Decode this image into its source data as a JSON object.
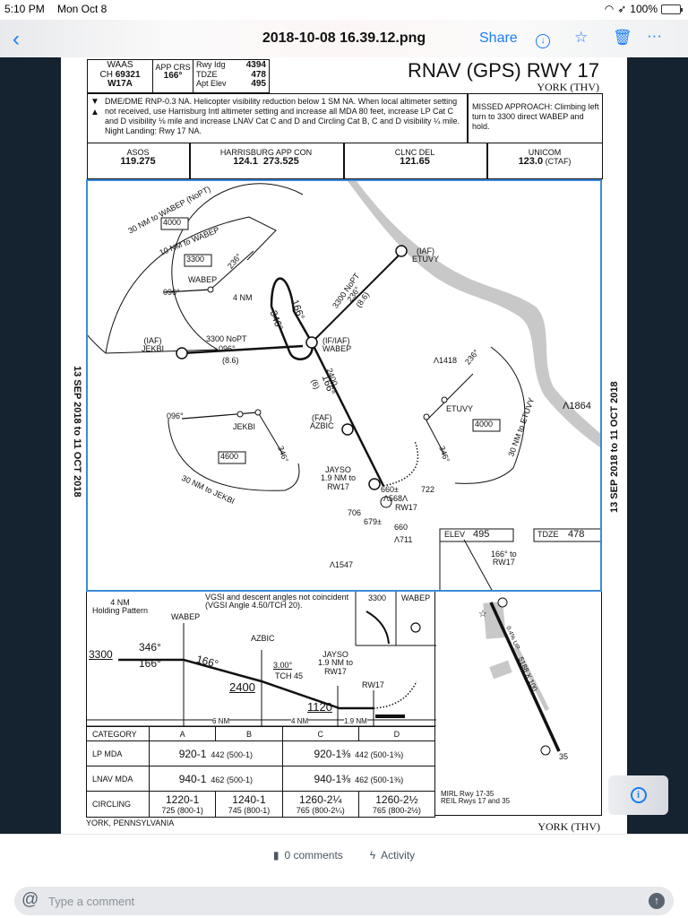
{
  "status_bar": {
    "time": "5:10 PM",
    "date": "Mon Oct 8",
    "battery": "100%"
  },
  "nav": {
    "back_label": "‹",
    "title": "2018-10-08 16.39.12.png",
    "share_label": "Share",
    "icons": [
      "download-icon",
      "star-icon",
      "trash-icon",
      "more-icon"
    ]
  },
  "chart": {
    "validity": "13 SEP 2018 to 11 OCT 2018",
    "header": {
      "waas_label": "WAAS",
      "ch_label": "CH",
      "ch_value": "69321",
      "waas_id": "W17A",
      "app_crs_label": "APP CRS",
      "app_crs_value": "166°",
      "rwy_ldg_label": "Rwy Idg",
      "rwy_ldg_value": "4394",
      "tdze_label": "TDZE",
      "tdze_value": "478",
      "apt_elev_label": "Apt Elev",
      "apt_elev_value": "495",
      "title": "RNAV (GPS) RWY 17",
      "subtitle": "YORK (THV)"
    },
    "notes": "DME/DME RNP-0.3 NA.  Helicopter visibility reduction below 1 SM NA.  When local altimeter setting not received, use Harrisburg Intl altimeter setting and increase all MDA 80 feet, increase LP Cat C and D visibility ⅛ mile and increase LNAV Cat C and D and Circling Cat B, C and D visibility ¼ mile. Night Landing: Rwy 17 NA.",
    "missed_approach": "MISSED APPROACH: Climbing left turn to 3300 direct WABEP and hold.",
    "comms": [
      {
        "label": "ASOS",
        "value": "119.275"
      },
      {
        "label": "HARRISBURG APP CON",
        "value": "124.1  273.525"
      },
      {
        "label": "CLNC DEL",
        "value": "121.65"
      },
      {
        "label": "UNICOM",
        "value": "123.0",
        "suffix": "(CTAF)"
      }
    ],
    "plan": {
      "taa_nw_outer": "30 NM to WABEP (NoPT)",
      "taa_nw_inner": "10 NM to WABEP",
      "taa_nw_alt_outer": "4000",
      "taa_nw_alt_inner": "3300",
      "taa_nw_fix": "WABEP",
      "taa_nw_096": "096°",
      "taa_nw_236": "236°",
      "hold_4nm": "4 NM",
      "hold_166": "166°",
      "hold_346": "346°",
      "jekbi_iaf": "(IAF)\nJEKBI",
      "jekbi_leg": "3300 NoPT",
      "jekbi_crs": "096°",
      "jekbi_dist": "(8.6)",
      "etuvy_iaf": "(IAF)\nETUVY",
      "etuvy_leg": "3300 NoPT",
      "etuvy_crs": "236°",
      "etuvy_dist": "(8.6)",
      "wabep_if": "(IF/IAF)\nWABEP",
      "seg_alt": "2400",
      "seg_crs": "166°",
      "seg_dist": "(6)",
      "faf": "(FAF)\nAZBIC",
      "jayso": "JAYSO\n1.9 NM to\nRW17",
      "taa_sw_096": "096°",
      "taa_sw_fix": "JEKBI",
      "taa_sw_alt": "4600",
      "taa_sw_346": "346°",
      "taa_sw_arc": "30 NM to JEKBI",
      "taa_e_236": "236°",
      "taa_e_fix": "ETUVY",
      "taa_e_alt": "4000",
      "taa_e_346": "346°",
      "taa_e_arc": "30 NM to ETUVY",
      "obstacles": [
        "1418",
        "1864",
        "660±",
        "722",
        "568",
        "706",
        "679±",
        "660",
        "711",
        "1547"
      ],
      "rw17": "RW17",
      "elev_label": "ELEV",
      "elev_value": "495",
      "tdze_label": "TDZE",
      "tdze_value": "478",
      "crs_to_rw": "166° to\nRW17"
    },
    "profile": {
      "holding_note": "4 NM\nHolding Pattern",
      "wabep": "WABEP",
      "vgsi_note": "VGSI and descent angles not coincident\n(VGSI Angle 4.50/TCH 20).",
      "alt_3300": "3300",
      "crs_346": "346°",
      "crs_166a": "166°",
      "crs_166b": "166°",
      "azbic": "AZBIC",
      "alt_2400": "2400",
      "gs_angle": "3.00°",
      "tch": "TCH 45",
      "jayso": "JAYSO\n1.9 NM to\nRW17",
      "rw17": "RW17",
      "alt_1120": "1120",
      "dist_6": "6 NM",
      "dist_4": "4 NM",
      "dist_19": "1.9 NM",
      "ma_icon_alt": "3300",
      "ma_icon_fix": "WABEP"
    },
    "minimums": {
      "headers": [
        "CATEGORY",
        "A",
        "B",
        "C",
        "D"
      ],
      "lp": {
        "label": "LP MDA",
        "ab_main": "920-1",
        "ab_sub": "442 (500-1)",
        "cd_main": "920-1⅜",
        "cd_sub": "442 (500-1⅜)"
      },
      "lnav": {
        "label": "LNAV MDA",
        "ab_main": "940-1",
        "ab_sub": "462 (500-1)",
        "cd_main": "940-1⅜",
        "cd_sub": "462 (500-1⅜)"
      },
      "circling": {
        "label": "CIRCLING",
        "a_main": "1220-1",
        "a_sub": "725 (800-1)",
        "b_main": "1240-1",
        "b_sub": "745 (800-1)",
        "c_main": "1260-2¼",
        "c_sub": "765 (800-2¼)",
        "d_main": "1260-2½",
        "d_sub": "765 (800-2½)"
      }
    },
    "airport": {
      "runway_dims": "5188 X 100",
      "gradient": "0.4% UP",
      "rwy_end": "35",
      "lighting": "MIRL Rwy 17-35\nREIL Rwys 17 and 35"
    },
    "footer_left": "YORK, PENNSYLVANIA",
    "footer_right": "YORK (THV)"
  },
  "bottom": {
    "comments_tab": "0 comments",
    "activity_tab": "Activity",
    "comment_placeholder": "Type a comment"
  },
  "colors": {
    "accent": "#1a7cf5",
    "viewer_bg": "#15222f",
    "plan_border": "#3b8ad9",
    "river": "#c8c8c8"
  }
}
